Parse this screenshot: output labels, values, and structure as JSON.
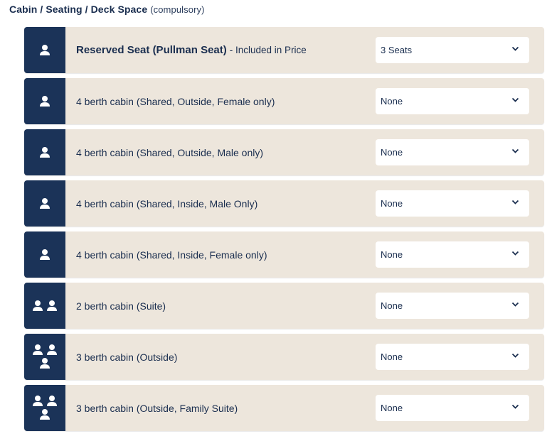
{
  "header": {
    "title": "Cabin / Seating / Deck Space",
    "note": "(compulsory)"
  },
  "options": [
    {
      "icon": "single-person-icon",
      "label": "Reserved Seat (Pullman Seat)",
      "suffix": "- Included in Price",
      "selected": "3 Seats"
    },
    {
      "icon": "single-person-icon",
      "label": "4 berth cabin (Shared, Outside, Female only)",
      "suffix": "",
      "selected": "None"
    },
    {
      "icon": "single-person-icon",
      "label": "4 berth cabin (Shared, Outside, Male only)",
      "suffix": "",
      "selected": "None"
    },
    {
      "icon": "single-person-icon",
      "label": "4 berth cabin (Shared, Inside, Male Only)",
      "suffix": "",
      "selected": "None"
    },
    {
      "icon": "single-person-icon",
      "label": "4 berth cabin (Shared, Inside, Female only)",
      "suffix": "",
      "selected": "None"
    },
    {
      "icon": "two-person-icon",
      "label": "2 berth cabin (Suite)",
      "suffix": "",
      "selected": "None"
    },
    {
      "icon": "three-person-icon",
      "label": "3 berth cabin (Outside)",
      "suffix": "",
      "selected": "None"
    },
    {
      "icon": "three-person-icon",
      "label": "3 berth cabin (Outside, Family Suite)",
      "suffix": "",
      "selected": "None"
    }
  ],
  "colors": {
    "icon_bg": "#1b3358",
    "row_bg": "#ede6dc",
    "text": "#1a2e4f"
  }
}
